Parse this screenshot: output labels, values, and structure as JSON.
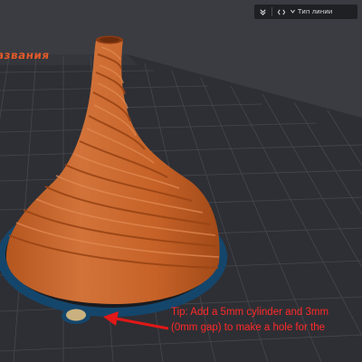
{
  "toolbar": {
    "collapse_icon": "chevrons-down-icon",
    "code_icon": "code-icon",
    "dropdown_icon": "chevron-down-icon",
    "linetype_label": "Тип линии"
  },
  "plate_label": "азвания",
  "tip": {
    "line1": "Tip: Add a 5mm cylinder and 3mm",
    "line2": "(0mm gap) to make a hole for the"
  },
  "colors": {
    "print_orange": "#c8652f",
    "plate_dark": "#2f3035",
    "grid_line": "#45464c",
    "brim_blue": "#15466c",
    "annotation_red": "#e01818",
    "plate_label": "#e05a2b"
  }
}
